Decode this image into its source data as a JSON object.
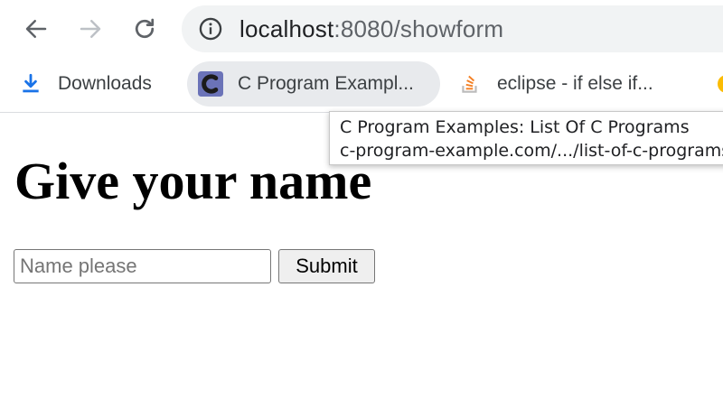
{
  "toolbar": {
    "back_icon": "arrow-left-icon",
    "forward_icon": "arrow-right-icon",
    "reload_icon": "reload-icon",
    "info_icon": "info-icon",
    "url_host": "localhost",
    "url_rest": ":8080/showform"
  },
  "bookmarks": {
    "items": [
      {
        "label": "Downloads",
        "icon": "download-icon"
      },
      {
        "label": "C Program Exampl...",
        "icon": "c-program-favicon"
      },
      {
        "label": "eclipse - if else if...",
        "icon": "stackoverflow-favicon"
      }
    ]
  },
  "tooltip": {
    "title": "C Program Examples: List Of C Programs",
    "url": "c-program-example.com/.../list-of-c-programs"
  },
  "form": {
    "heading": "Give your name",
    "name_placeholder": "Name please",
    "submit_label": "Submit"
  },
  "colors": {
    "omnibox_bg": "#f1f3f4",
    "download_blue": "#1a73e8",
    "stackoverflow_orange": "#f48024"
  }
}
